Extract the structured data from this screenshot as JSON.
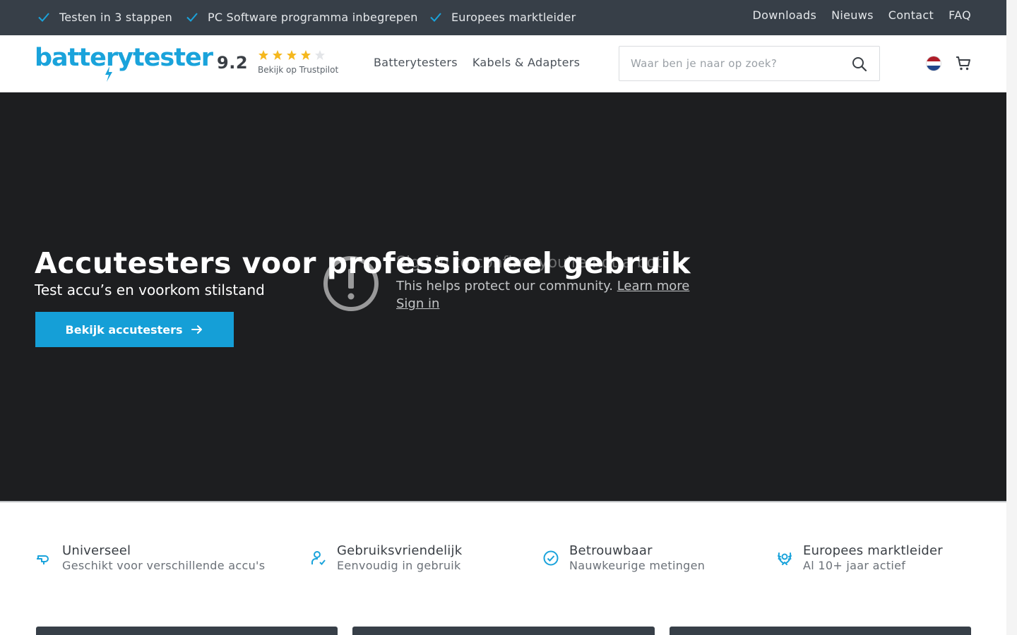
{
  "topbar": {
    "usps": [
      "Testen in 3 stappen",
      "PC Software programma inbegrepen",
      "Europees marktleider"
    ],
    "links": [
      "Downloads",
      "Nieuws",
      "Contact",
      "FAQ"
    ]
  },
  "header": {
    "logo": "batterytester",
    "rating": "9.2",
    "stars_filled": 4,
    "stars_total": 5,
    "trustpilot": "Bekijk op Trustpilot",
    "nav": [
      "Batterytesters",
      "Kabels & Adapters"
    ],
    "search_placeholder": "Waar ben je naar op zoek?"
  },
  "hero": {
    "title": "Accutesters voor professioneel gebruik",
    "subtitle": "Test accu’s en voorkom stilstand",
    "button": "Bekijk accutesters"
  },
  "overlay": {
    "title": "Sign in to confirm you're not a bot",
    "text": "This helps protect our community.",
    "learn_more": "Learn more",
    "sign_in": "Sign in"
  },
  "features": [
    {
      "title": "Universeel",
      "sub": "Geschikt voor verschillende accu's",
      "icon": "plug-icon"
    },
    {
      "title": "Gebruiksvriendelijk",
      "sub": "Eenvoudig in gebruik",
      "icon": "user-check-icon"
    },
    {
      "title": "Betrouwbaar",
      "sub": "Nauwkeurige metingen",
      "icon": "check-circle-icon"
    },
    {
      "title": "Europees marktleider",
      "sub": "Al 10+ jaar actief",
      "icon": "laurel-icon"
    }
  ],
  "colors": {
    "topbar": "#373f48",
    "accent": "#1aa3db",
    "hero_bg": "#1d1e20",
    "star": "#f5b81e"
  }
}
